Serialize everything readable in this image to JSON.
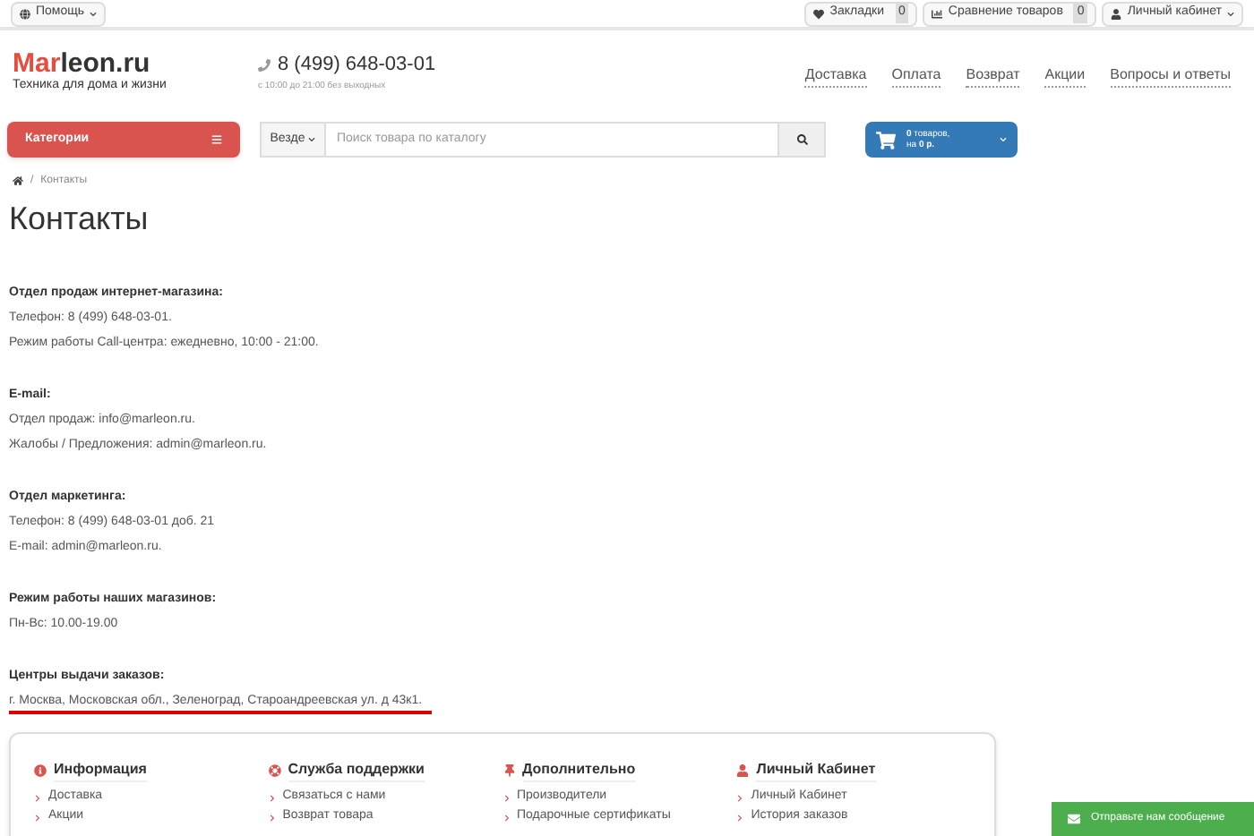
{
  "topbar": {
    "help": "Помощь",
    "bookmarks": {
      "label": "Закладки",
      "count": "0"
    },
    "compare": {
      "label": "Сравнение товаров",
      "count": "0"
    },
    "account": "Личный кабинет"
  },
  "header": {
    "logo_accent": "Mar",
    "logo_rest": "leon.ru",
    "tagline": "Техника для дома и жизни",
    "phone": "8 (499) 648-03-01",
    "hours": "с 10:00 до 21:00 без выходных",
    "nav": [
      "Доставка",
      "Оплата",
      "Возврат",
      "Акции",
      "Вопросы и ответы"
    ]
  },
  "searchbar": {
    "categories": "Категории",
    "scope": "Везде",
    "placeholder": "Поиск товара по каталогу",
    "cart_count": "0 товаров,",
    "cart_prefix": "на",
    "cart_sum": "0 р."
  },
  "breadcrumb": [
    {
      "separator": "/",
      "label": "Контакты"
    }
  ],
  "title": "Контакты",
  "sections": [
    {
      "heading": "Отдел продаж интернет-магазина:",
      "lines": [
        "Телефон: 8 (499) 648-03-01.",
        "Режим работы Call-центра: ежедневно, 10:00 - 21:00."
      ],
      "underlined": false
    },
    {
      "heading": "E-mail:",
      "lines": [
        "Отдел продаж: info@marleon.ru.",
        "Жалобы / Предложения: admin@marleon.ru."
      ],
      "underlined": false
    },
    {
      "heading": "Отдел маркетинга:",
      "lines": [
        "Телефон: 8 (499) 648-03-01 доб. 21",
        "E-mail: admin@marleon.ru."
      ],
      "underlined": false
    },
    {
      "heading": "Режим работы наших магазинов:",
      "lines": [
        "Пн-Вс: 10.00-19.00"
      ],
      "underlined": false
    },
    {
      "heading": "Центры выдачи заказов:",
      "lines": [
        "г. Москва, Московская обл., Зеленоград, Староандреевская ул. д 43к1."
      ],
      "underlined": true
    }
  ],
  "footer": [
    {
      "kind": "info",
      "title": "Информация",
      "links": [
        "Доставка",
        "Акции"
      ]
    },
    {
      "kind": "support",
      "title": "Служба поддержки",
      "links": [
        "Связаться с нами",
        "Возврат товара"
      ]
    },
    {
      "kind": "extra",
      "title": "Дополнительно",
      "links": [
        "Производители",
        "Подарочные сертификаты"
      ]
    },
    {
      "kind": "account",
      "title": "Личный Кабинет",
      "links": [
        "Личный Кабинет",
        "История заказов"
      ]
    }
  ],
  "chat_button": "Отправьте нам сообщение"
}
